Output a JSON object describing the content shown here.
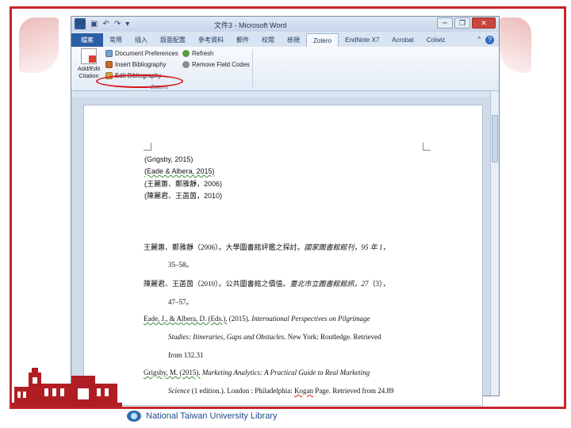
{
  "window": {
    "title": "文件3 - Microsoft Word",
    "qat": {
      "app_icon": "W",
      "save_icon": "save-icon",
      "undo_icon": "undo-icon",
      "redo_icon": "redo-icon"
    },
    "controls": [
      "─",
      "❐",
      "✕"
    ]
  },
  "tabs": [
    {
      "label": "檔案",
      "kind": "file"
    },
    {
      "label": "常用"
    },
    {
      "label": "插入"
    },
    {
      "label": "版面配置"
    },
    {
      "label": "參考資料"
    },
    {
      "label": "郵件"
    },
    {
      "label": "校閱"
    },
    {
      "label": "檢視"
    },
    {
      "label": "Zotero",
      "active": true
    },
    {
      "label": "EndNote X7"
    },
    {
      "label": "Acrobat"
    },
    {
      "label": "Colwiz"
    }
  ],
  "ribbon": {
    "add_edit_citation": "Add/Edit Citation",
    "document_preferences": "Document Preferences",
    "insert_bibliography": "Insert Bibliography",
    "edit_bibliography": "Edit Bibliography",
    "refresh": "Refresh",
    "remove_field_codes": "Remove Field Codes",
    "group_label": "Zotero"
  },
  "document": {
    "citations": [
      "(Grigsby, 2015)",
      "(Eade & Albera, 2015)",
      "(王麗蕙、鄭雅靜，2006)",
      "(陳麗君、王菡茵，2010)"
    ],
    "references": {
      "r1_a": "王麗蕙、鄭雅靜（2006）。大學圖書館評鑑之探討。",
      "r1_b": "國家圖書館館刊，95 年 1",
      "r1_c": "，",
      "r1_d": "35–58。",
      "r2_a": "陳麗君、王菡茵（2010）。公共圖書館之價值。",
      "r2_b": "臺北市立圖書館館訊，27",
      "r2_c": "（3），",
      "r2_d": "47–57。",
      "r3_a": "Eade, J., & Albera, D. (Eds.).",
      "r3_b": " (2015). ",
      "r3_c": "International Perspectives on Pilgrimage",
      "r3_d": "Studies: Itineraries, Gaps and Obstacles",
      "r3_e": ". New York: Routledge. Retrieved",
      "r3_f": "from 132.31",
      "r4_a": "Grigsby, M. (2015).",
      "r4_b": " ",
      "r4_c": "Marketing Analytics: A Practical Guide to Real Marketing",
      "r4_d": "Science",
      "r4_e": " (1 edition.). London : Philadelphia: ",
      "r4_f": "Kogan",
      "r4_g": " Page. Retrieved from 24.89"
    }
  },
  "footer": {
    "library_name": "National Taiwan University Library"
  },
  "colors": {
    "frame": "#c3262c",
    "highlight": "#d8151b",
    "file_tab": "#2c5ea5",
    "library_text": "#1f4c8a"
  }
}
